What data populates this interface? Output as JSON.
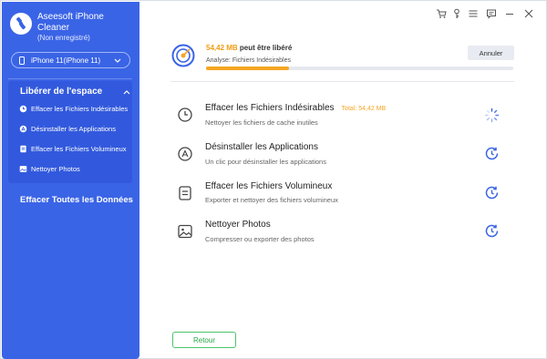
{
  "app": {
    "title": "Aseesoft iPhone Cleaner",
    "subtitle": "(Non enregistré)",
    "accent": "#3a64e6",
    "logo_icon": "satellite-logo-icon"
  },
  "device": {
    "label": "iPhone 11(iPhone 11)",
    "icon": "phone-icon"
  },
  "titlebar": {
    "icons": [
      "cart-icon",
      "key-icon",
      "menu-icon",
      "feedback-icon",
      "minimize-icon",
      "close-icon"
    ]
  },
  "sidebar": {
    "section_title": "Libérer de l'espace",
    "items": [
      {
        "label": "Effacer les Fichiers Indésirables",
        "icon": "clock-icon"
      },
      {
        "label": "Désinstaller les Applications",
        "icon": "app-store-icon"
      },
      {
        "label": "Effacer les Fichiers Volumineux",
        "icon": "document-icon"
      },
      {
        "label": "Nettoyer Photos",
        "icon": "image-icon"
      }
    ],
    "erase_all": "Effacer Toutes les Données"
  },
  "scan": {
    "amount": "54,42 MB",
    "freed_text": "peut être libéré",
    "analysis_label": "Analyse:",
    "analysis_value": "Fichiers Indésirables",
    "progress": 0.27,
    "cancel_label": "Annuler"
  },
  "tasks": [
    {
      "title": "Effacer les Fichiers Indésirables",
      "total": "Total: 54,42 MB",
      "desc": "Nettoyer les fichiers de cache inutiles",
      "icon": "clock-icon",
      "status": "loading-spinner-icon"
    },
    {
      "title": "Désinstaller les Applications",
      "total": "",
      "desc": "Un clic pour désinstaller les applications",
      "icon": "app-store-icon",
      "status": "pending-clock-icon"
    },
    {
      "title": "Effacer les Fichiers Volumineux",
      "total": "",
      "desc": "Exporter et nettoyer des fichiers volumineux",
      "icon": "document-icon",
      "status": "pending-clock-icon"
    },
    {
      "title": "Nettoyer Photos",
      "total": "",
      "desc": "Compresser ou exporter des photos",
      "icon": "image-icon",
      "status": "pending-clock-icon"
    }
  ],
  "footer": {
    "back_label": "Retour"
  }
}
